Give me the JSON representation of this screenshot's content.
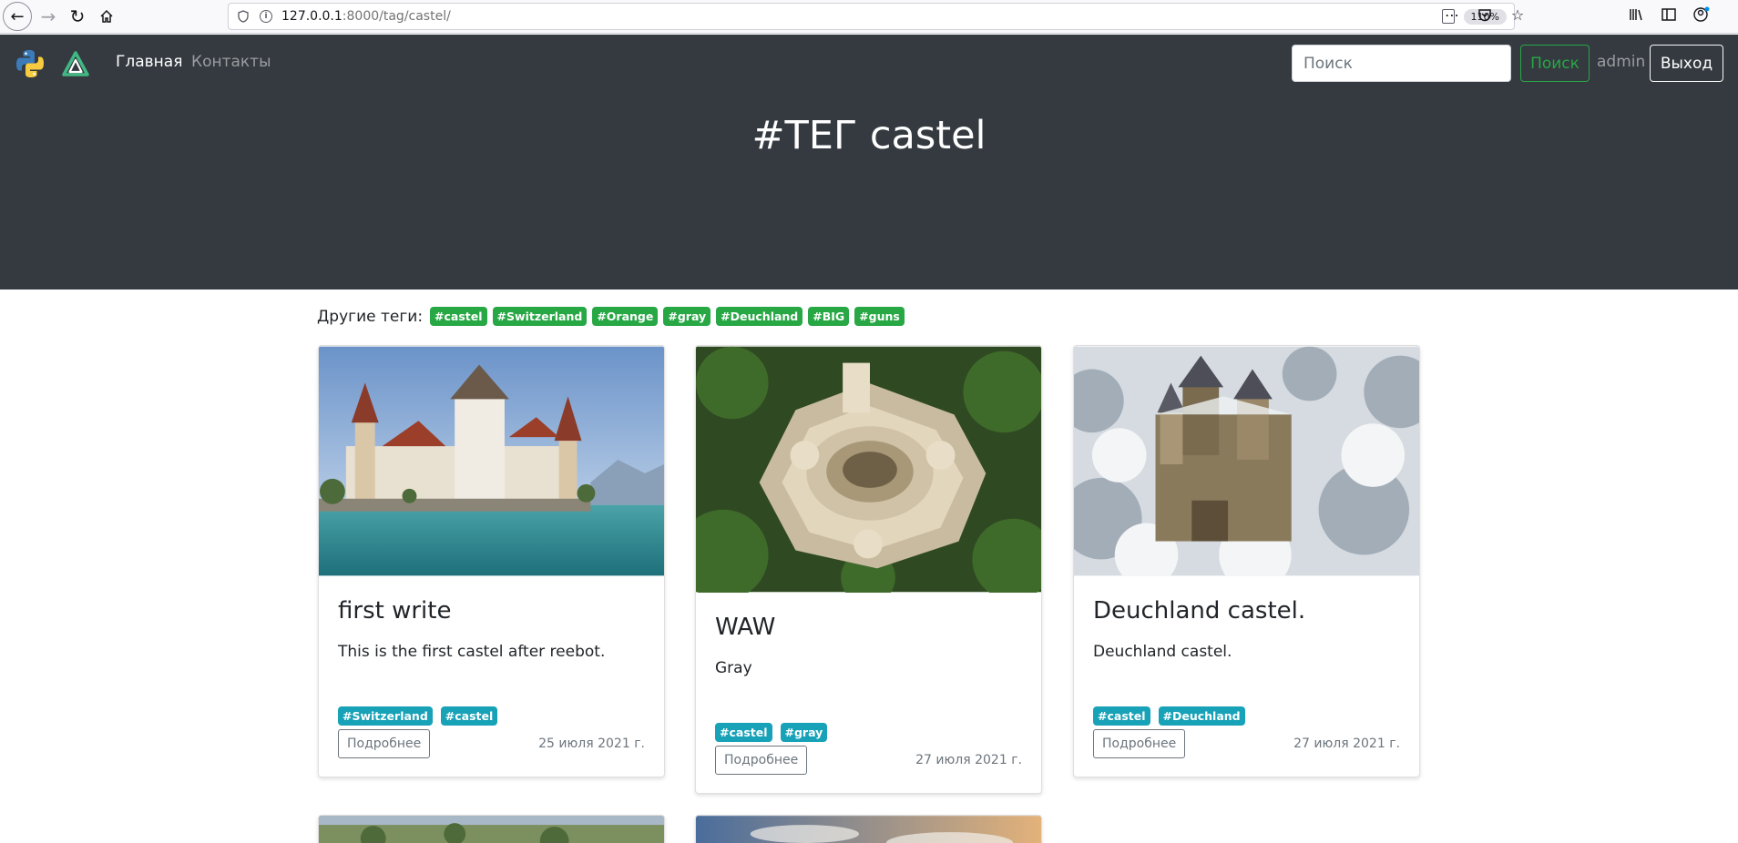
{
  "browser": {
    "url_host": "127.0.0.1",
    "url_rest": ":8000/tag/castel/",
    "zoom": "110%"
  },
  "nav": {
    "home_label": "Главная",
    "contacts_label": "Контакты",
    "search_placeholder": "Поиск",
    "search_button": "Поиск",
    "user": "admin",
    "logout": "Выход"
  },
  "hero": {
    "title": "#ТЕГ castel"
  },
  "other_tags": {
    "label": "Другие теги:",
    "tags": [
      "#castel",
      "#Switzerland",
      "#Orange",
      "#gray",
      "#Deuchland",
      "#BIG",
      "#guns"
    ]
  },
  "cards": [
    {
      "title": "first write",
      "text": "This is the first castel after reebot.",
      "tags": [
        "#Switzerland",
        "#castel"
      ],
      "button": "Подробнее",
      "date": "25 июля 2021 г."
    },
    {
      "title": "WAW",
      "text": "Gray",
      "tags": [
        "#castel",
        "#gray"
      ],
      "button": "Подробнее",
      "date": "27 июля 2021 г."
    },
    {
      "title": "Deuchland castel.",
      "text": "Deuchland castel.",
      "tags": [
        "#castel",
        "#Deuchland"
      ],
      "button": "Подробнее",
      "date": "27 июля 2021 г."
    }
  ],
  "colors": {
    "navbar_bg": "#343a40",
    "tag_green": "#28a745",
    "tag_teal": "#17a2b8"
  }
}
